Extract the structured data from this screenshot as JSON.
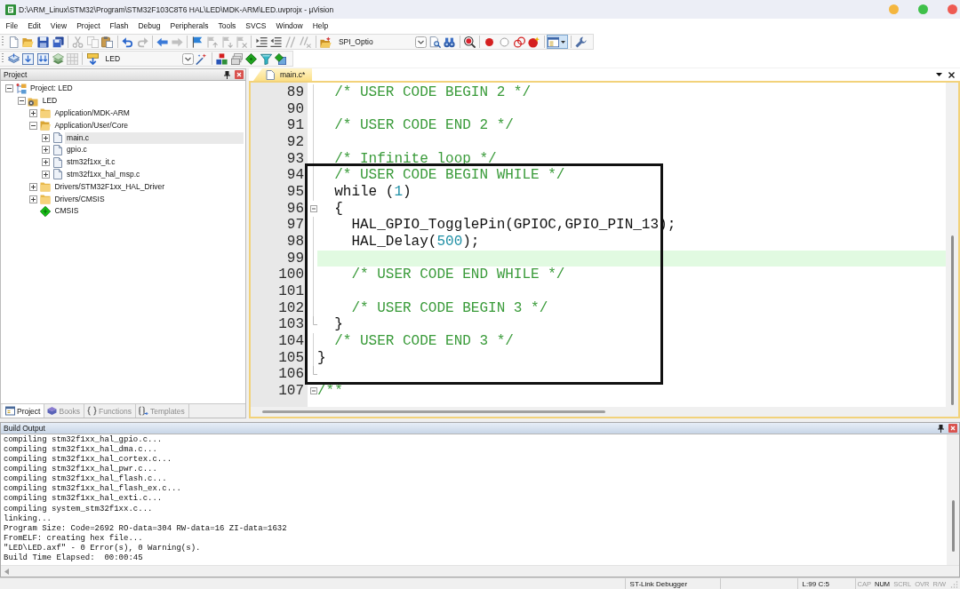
{
  "window": {
    "title": "D:\\ARM_Linux\\STM32\\Program\\STM32F103C8T6 HAL\\LED\\MDK-ARM\\LED.uvprojx - µVision"
  },
  "menu": [
    "File",
    "Edit",
    "View",
    "Project",
    "Flash",
    "Debug",
    "Peripherals",
    "Tools",
    "SVCS",
    "Window",
    "Help"
  ],
  "toolbars": [
    {
      "items": [
        {
          "kind": "new-file",
          "disabled": false,
          "pressed": false
        },
        {
          "kind": "open",
          "disabled": false,
          "pressed": false
        },
        {
          "kind": "save",
          "disabled": false,
          "pressed": false
        },
        {
          "kind": "save-all",
          "disabled": false,
          "pressed": false
        },
        {
          "kind": "separator"
        },
        {
          "kind": "cut",
          "disabled": true,
          "pressed": false
        },
        {
          "kind": "copy",
          "disabled": true,
          "pressed": false
        },
        {
          "kind": "paste",
          "disabled": false,
          "pressed": false
        },
        {
          "kind": "separator"
        },
        {
          "kind": "undo",
          "disabled": false,
          "pressed": false
        },
        {
          "kind": "redo",
          "disabled": true,
          "pressed": false
        },
        {
          "kind": "separator"
        },
        {
          "kind": "back",
          "disabled": false,
          "pressed": false
        },
        {
          "kind": "forward",
          "disabled": true,
          "pressed": false
        },
        {
          "kind": "separator"
        },
        {
          "kind": "bookmark",
          "disabled": false,
          "pressed": false
        },
        {
          "kind": "bookmark-prev",
          "disabled": true,
          "pressed": false
        },
        {
          "kind": "bookmark-next",
          "disabled": true,
          "pressed": false
        },
        {
          "kind": "bookmark-clear",
          "disabled": true,
          "pressed": false
        },
        {
          "kind": "separator"
        },
        {
          "kind": "indent",
          "disabled": false,
          "pressed": false
        },
        {
          "kind": "unindent",
          "disabled": false,
          "pressed": false
        },
        {
          "kind": "comment",
          "disabled": true,
          "pressed": false
        },
        {
          "kind": "uncomment",
          "disabled": true,
          "pressed": false
        },
        {
          "kind": "separator"
        },
        {
          "kind": "manage-project",
          "disabled": false,
          "pressed": false
        },
        {
          "kind": "combo",
          "value": "SPI_Optio"
        },
        {
          "kind": "find-in-files",
          "disabled": false,
          "pressed": false
        },
        {
          "kind": "browse",
          "disabled": false,
          "pressed": false
        },
        {
          "kind": "separator"
        },
        {
          "kind": "debug",
          "disabled": false,
          "pressed": false
        },
        {
          "kind": "separator"
        },
        {
          "kind": "breakpoint",
          "disabled": false,
          "pressed": false
        },
        {
          "kind": "breakpoint-toggle",
          "disabled": false,
          "pressed": false
        },
        {
          "kind": "breakpoint-kill",
          "disabled": false,
          "pressed": false
        },
        {
          "kind": "breakpoint-star",
          "disabled": false,
          "pressed": false
        },
        {
          "kind": "separator"
        },
        {
          "kind": "window-menu",
          "disabled": false,
          "pressed": true
        },
        {
          "kind": "separator"
        },
        {
          "kind": "wrench",
          "disabled": false,
          "pressed": false
        }
      ]
    },
    {
      "items": [
        {
          "kind": "translate",
          "disabled": false,
          "pressed": false
        },
        {
          "kind": "build",
          "disabled": false,
          "pressed": false
        },
        {
          "kind": "rebuild",
          "disabled": false,
          "pressed": false
        },
        {
          "kind": "batch-build",
          "disabled": false,
          "pressed": false
        },
        {
          "kind": "stop",
          "disabled": true,
          "pressed": false
        },
        {
          "kind": "separator"
        },
        {
          "kind": "download",
          "disabled": false,
          "pressed": false
        },
        {
          "kind": "combo",
          "value": "LED"
        },
        {
          "kind": "options",
          "disabled": false,
          "pressed": false
        },
        {
          "kind": "separator"
        },
        {
          "kind": "components",
          "disabled": false,
          "pressed": false
        },
        {
          "kind": "extensions",
          "disabled": false,
          "pressed": false
        },
        {
          "kind": "pack-installer",
          "disabled": false,
          "pressed": false
        },
        {
          "kind": "select-packs",
          "disabled": false,
          "pressed": false
        },
        {
          "kind": "environment",
          "disabled": false,
          "pressed": false
        }
      ]
    }
  ],
  "project_panel": {
    "title": "Project",
    "tree": [
      {
        "kind": "project",
        "label": "Project: LED",
        "expanded": true,
        "selected": false,
        "children": [
          {
            "kind": "target",
            "label": "LED",
            "expanded": true,
            "selected": false,
            "children": [
              {
                "kind": "group",
                "label": "Application/MDK-ARM",
                "expanded": false,
                "selected": false
              },
              {
                "kind": "group",
                "label": "Application/User/Core",
                "expanded": true,
                "selected": false,
                "children": [
                  {
                    "kind": "file",
                    "label": "main.c",
                    "expanded": false,
                    "selected": true
                  },
                  {
                    "kind": "file",
                    "label": "gpio.c",
                    "expanded": false,
                    "selected": false
                  },
                  {
                    "kind": "file",
                    "label": "stm32f1xx_it.c",
                    "expanded": false,
                    "selected": false
                  },
                  {
                    "kind": "file",
                    "label": "stm32f1xx_hal_msp.c",
                    "expanded": false,
                    "selected": false
                  }
                ]
              },
              {
                "kind": "group",
                "label": "Drivers/STM32F1xx_HAL_Driver",
                "expanded": false,
                "selected": false
              },
              {
                "kind": "group",
                "label": "Drivers/CMSIS",
                "expanded": false,
                "selected": false
              },
              {
                "kind": "component",
                "label": "CMSIS",
                "selected": false
              }
            ]
          }
        ]
      }
    ],
    "tabs": [
      {
        "kind": "project",
        "label": "Project",
        "selected": true
      },
      {
        "kind": "books",
        "label": "Books",
        "selected": false
      },
      {
        "kind": "functions",
        "label": "Functions",
        "selected": false
      },
      {
        "kind": "templates",
        "label": "Templates",
        "selected": false
      }
    ]
  },
  "editor": {
    "tabs": [
      {
        "label": "main.c*",
        "selected": true
      }
    ],
    "lines": [
      {
        "number": "89",
        "fold_start": false,
        "fold_end": false,
        "highlighted": false,
        "tokens": [
          {
            "kind": "comment",
            "text": "  /* USER CODE BEGIN 2 */"
          }
        ]
      },
      {
        "number": "90",
        "fold_start": false,
        "fold_end": false,
        "highlighted": false
      },
      {
        "number": "91",
        "fold_start": false,
        "fold_end": false,
        "highlighted": false,
        "tokens": [
          {
            "kind": "comment",
            "text": "  /* USER CODE END 2 */"
          }
        ]
      },
      {
        "number": "92",
        "fold_start": false,
        "fold_end": false,
        "highlighted": false
      },
      {
        "number": "93",
        "fold_start": false,
        "fold_end": false,
        "highlighted": false,
        "tokens": [
          {
            "kind": "comment",
            "text": "  /* Infinite loop */"
          }
        ]
      },
      {
        "number": "94",
        "fold_start": false,
        "fold_end": false,
        "highlighted": false,
        "tokens": [
          {
            "kind": "comment",
            "text": "  /* USER CODE BEGIN WHILE */"
          }
        ]
      },
      {
        "number": "95",
        "fold_start": false,
        "fold_end": false,
        "highlighted": false,
        "tokens": [
          {
            "kind": "plain",
            "text": "  while ("
          },
          {
            "kind": "number",
            "text": "1"
          },
          {
            "kind": "plain",
            "text": ")"
          }
        ]
      },
      {
        "number": "96",
        "fold_start": true,
        "fold_end": false,
        "highlighted": false,
        "tokens": [
          {
            "kind": "plain",
            "text": "  {"
          }
        ]
      },
      {
        "number": "97",
        "fold_start": false,
        "fold_end": false,
        "highlighted": false,
        "tokens": [
          {
            "kind": "plain",
            "text": "    HAL_GPIO_TogglePin(GPIOC,GPIO_PIN_13);"
          }
        ]
      },
      {
        "number": "98",
        "fold_start": false,
        "fold_end": false,
        "highlighted": false,
        "tokens": [
          {
            "kind": "plain",
            "text": "    HAL_Delay("
          },
          {
            "kind": "number",
            "text": "500"
          },
          {
            "kind": "plain",
            "text": ");"
          }
        ]
      },
      {
        "number": "99",
        "fold_start": false,
        "fold_end": false,
        "highlighted": true
      },
      {
        "number": "100",
        "fold_start": false,
        "fold_end": false,
        "highlighted": false,
        "tokens": [
          {
            "kind": "comment",
            "text": "    /* USER CODE END WHILE */"
          }
        ]
      },
      {
        "number": "101",
        "fold_start": false,
        "fold_end": false,
        "highlighted": false
      },
      {
        "number": "102",
        "fold_start": false,
        "fold_end": false,
        "highlighted": false,
        "tokens": [
          {
            "kind": "comment",
            "text": "    /* USER CODE BEGIN 3 */"
          }
        ]
      },
      {
        "number": "103",
        "fold_start": false,
        "fold_end": true,
        "highlighted": false,
        "tokens": [
          {
            "kind": "plain",
            "text": "  }"
          }
        ]
      },
      {
        "number": "104",
        "fold_start": false,
        "fold_end": false,
        "highlighted": false,
        "tokens": [
          {
            "kind": "comment",
            "text": "  /* USER CODE END 3 */"
          }
        ]
      },
      {
        "number": "105",
        "fold_start": false,
        "fold_end": false,
        "highlighted": false,
        "tokens": [
          {
            "kind": "plain",
            "text": "}"
          }
        ]
      },
      {
        "number": "106",
        "fold_start": false,
        "fold_end": true,
        "highlighted": false
      },
      {
        "number": "107",
        "fold_start": true,
        "fold_end": false,
        "highlighted": false,
        "tokens": [
          {
            "kind": "comment",
            "text": "/**"
          }
        ]
      }
    ],
    "annotation": {
      "kind": "rectangle"
    }
  },
  "build_output": {
    "title": "Build Output",
    "lines": [
      "compiling stm32f1xx_hal_gpio.c...",
      "compiling stm32f1xx_hal_dma.c...",
      "compiling stm32f1xx_hal_cortex.c...",
      "compiling stm32f1xx_hal_pwr.c...",
      "compiling stm32f1xx_hal_flash.c...",
      "compiling stm32f1xx_hal_flash_ex.c...",
      "compiling stm32f1xx_hal_exti.c...",
      "compiling system_stm32f1xx.c...",
      "linking...",
      "Program Size: Code=2692 RO-data=304 RW-data=16 ZI-data=1632",
      "FromELF: creating hex file...",
      "\"LED\\LED.axf\" - 0 Error(s), 0 Warning(s).",
      "Build Time Elapsed:  00:00:45"
    ]
  },
  "status_bar": {
    "debugger": "ST-Link Debugger",
    "position": "L:99 C:5",
    "indicators": [
      {
        "label": "CAP",
        "on": false
      },
      {
        "label": "NUM",
        "on": true
      },
      {
        "label": "SCRL",
        "on": false
      },
      {
        "label": "OVR",
        "on": false
      },
      {
        "label": "R/W",
        "on": false
      }
    ]
  }
}
